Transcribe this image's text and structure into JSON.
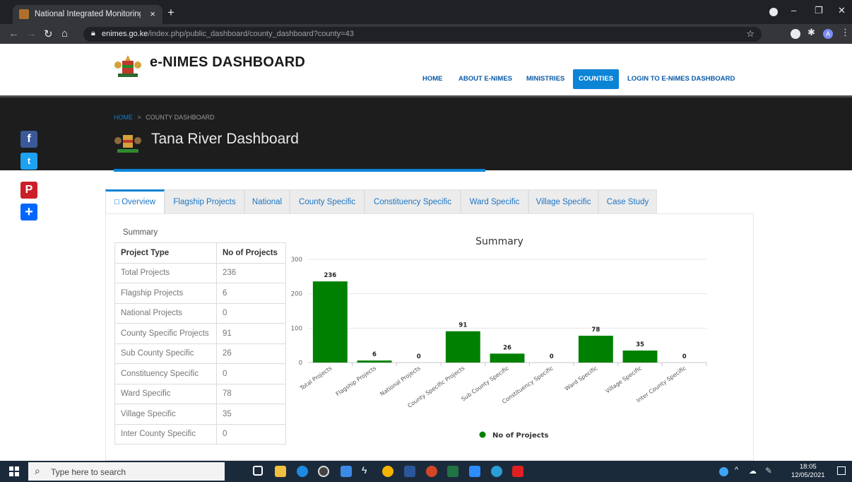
{
  "browser": {
    "tab_title": "National Integrated Monitoring a",
    "tab_close": "×",
    "new_tab": "+",
    "url_host": "enimes.go.ke",
    "url_path": "/index.php/public_dashboard/county_dashboard?county=43",
    "avatar_letter": "A",
    "win_min": "–",
    "win_max": "❐",
    "win_close": "✕"
  },
  "site": {
    "brand": "e-NIMES DASHBOARD",
    "menu": [
      {
        "label": "HOME"
      },
      {
        "label": "ABOUT E-NIMES"
      },
      {
        "label": "MINISTRIES"
      },
      {
        "label": "COUNTIES"
      },
      {
        "label": "LOGIN TO E-NIMES DASHBOARD"
      }
    ]
  },
  "banner": {
    "crumb_home": "HOME",
    "crumb_sep": ">",
    "crumb_current": "COUNTY DASHBOARD",
    "title": "Tana River Dashboard"
  },
  "share": {
    "facebook": "f",
    "twitter": "t",
    "pinterest": "P",
    "more": "+"
  },
  "tabs": [
    {
      "label": "□ Overview"
    },
    {
      "label": "Flagship Projects"
    },
    {
      "label": "National"
    },
    {
      "label": "County Specific"
    },
    {
      "label": "Constituency Specific"
    },
    {
      "label": "Ward Specific"
    },
    {
      "label": "Village Specific"
    },
    {
      "label": "Case Study"
    }
  ],
  "summary": {
    "label": "Summary",
    "col_type": "Project Type",
    "col_count": "No of Projects",
    "rows": [
      {
        "type": "Total Projects",
        "count": "236"
      },
      {
        "type": "Flagship Projects",
        "count": "6"
      },
      {
        "type": "National Projects",
        "count": "0"
      },
      {
        "type": "County Specific Projects",
        "count": "91"
      },
      {
        "type": "Sub County Specific",
        "count": "26"
      },
      {
        "type": "Constituency Specific",
        "count": "0"
      },
      {
        "type": "Ward Specific",
        "count": "78"
      },
      {
        "type": "Village Specific",
        "count": "35"
      },
      {
        "type": "Inter County Specific",
        "count": "0"
      }
    ]
  },
  "chart_data": {
    "type": "bar",
    "title": "Summary",
    "categories": [
      "Total Projects",
      "Flagship Projects",
      "National Projects",
      "County Specific Projects",
      "Sub County Specific",
      "Constituency Specific",
      "Ward Specific",
      "Village Specific",
      "Inter County Specific"
    ],
    "series": [
      {
        "name": "No of Projects",
        "values": [
          236,
          6,
          0,
          91,
          26,
          0,
          78,
          35,
          0
        ],
        "color": "#008000"
      }
    ],
    "ylim": [
      0,
      300
    ],
    "yticks": [
      0,
      100,
      200,
      300
    ],
    "grid": true,
    "legend": "bottom"
  },
  "taskbar": {
    "search_placeholder": "Type here to search",
    "time": "18:05",
    "date": "12/05/2021"
  }
}
